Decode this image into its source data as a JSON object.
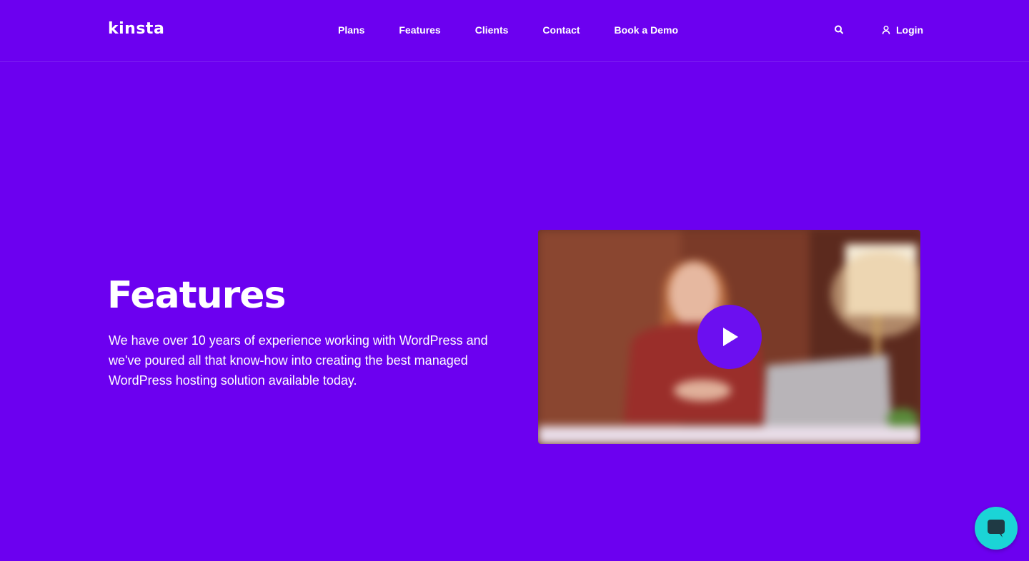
{
  "brand": {
    "logo_text": "kinsta"
  },
  "nav": {
    "items": [
      {
        "label": "Plans"
      },
      {
        "label": "Features"
      },
      {
        "label": "Clients"
      },
      {
        "label": "Contact"
      },
      {
        "label": "Book a Demo"
      }
    ],
    "search_icon": "search-icon",
    "login_label": "Login",
    "login_icon": "user-icon"
  },
  "hero": {
    "title": "Features",
    "description": "We have over 10 years of experience working with WordPress and we've poured all that know-how into creating the best managed WordPress hosting solution available today."
  },
  "video": {
    "play_icon": "play-icon"
  },
  "chat": {
    "icon": "chat-icon"
  },
  "colors": {
    "background": "#6c00f0",
    "play_button": "#6c0ff0",
    "chat_button": "#1bd4d6",
    "text": "#ffffff"
  }
}
